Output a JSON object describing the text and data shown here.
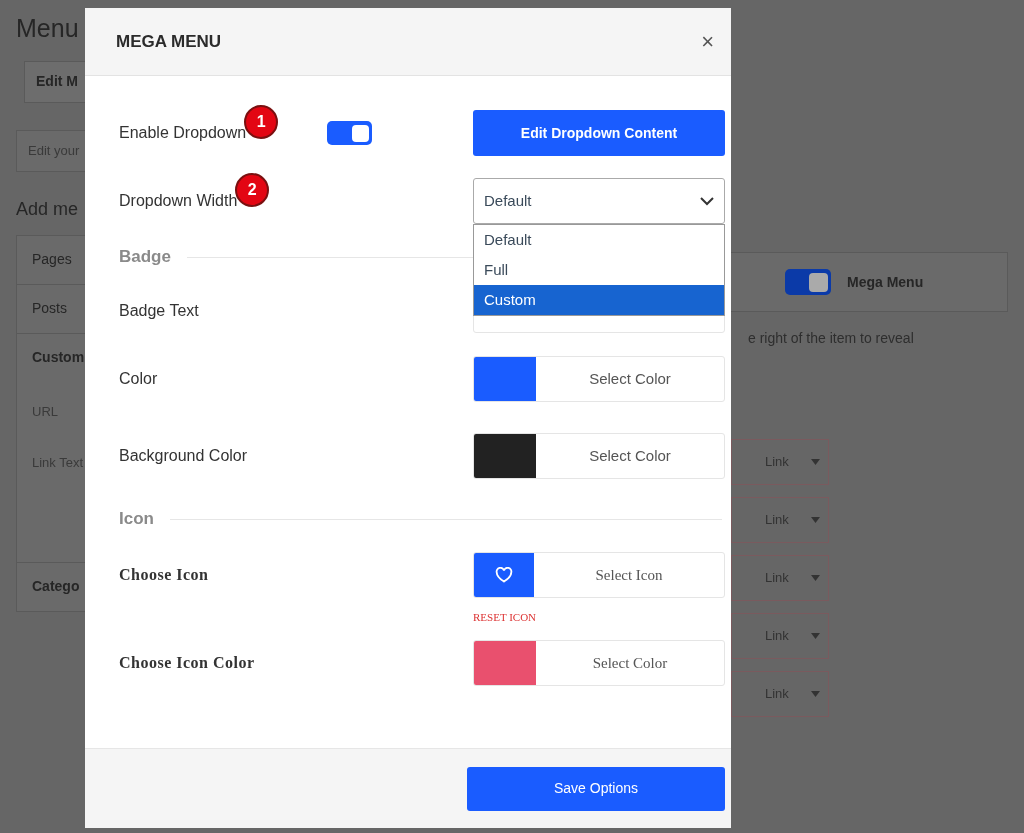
{
  "background": {
    "page_title": "Menu",
    "tab": "Edit M",
    "hint": "Edit your",
    "section_title": "Add me",
    "accordion": [
      {
        "label": "Pages",
        "expanded": false
      },
      {
        "label": "Posts",
        "expanded": false
      },
      {
        "label": "Custom",
        "expanded": true
      }
    ],
    "fields": [
      {
        "label": "URL"
      },
      {
        "label": "Link Text"
      }
    ],
    "accordion_last": "Catego",
    "right_panel": {
      "toggle": {
        "on": true
      },
      "title": "Mega Menu",
      "text": "e right of the item to reveal",
      "items": [
        "Link",
        "Link",
        "Link",
        "Link",
        "Link"
      ]
    }
  },
  "modal": {
    "title": "MEGA MENU",
    "close": "×",
    "rows": [
      {
        "kind": "toggle",
        "label": "Enable Dropdown",
        "marker": "1",
        "on": true,
        "button": "Edit Dropdown Content"
      },
      {
        "kind": "select",
        "label": "Dropdown Width",
        "marker": "2",
        "value": "Default",
        "expanded": true,
        "options": [
          {
            "label": "Default",
            "highlighted": false
          },
          {
            "label": "Full",
            "highlighted": false
          },
          {
            "label": "Custom",
            "highlighted": true
          }
        ]
      },
      {
        "kind": "section",
        "label": "Badge"
      },
      {
        "kind": "text",
        "label": "Badge Text"
      },
      {
        "kind": "color",
        "label": "Color",
        "color": "#1a5cff",
        "button": "Select Color"
      },
      {
        "kind": "color",
        "label": "Background Color",
        "color": "#222222",
        "button": "Select Color"
      },
      {
        "kind": "section",
        "label": "Icon"
      },
      {
        "kind": "icon",
        "label": "Choose Icon",
        "button": "Select Icon",
        "reset": "RESET ICON"
      },
      {
        "kind": "color_serif",
        "label": "Choose Icon Color",
        "color": "#e9506e",
        "button": "Select Color"
      }
    ],
    "save": "Save Options"
  }
}
